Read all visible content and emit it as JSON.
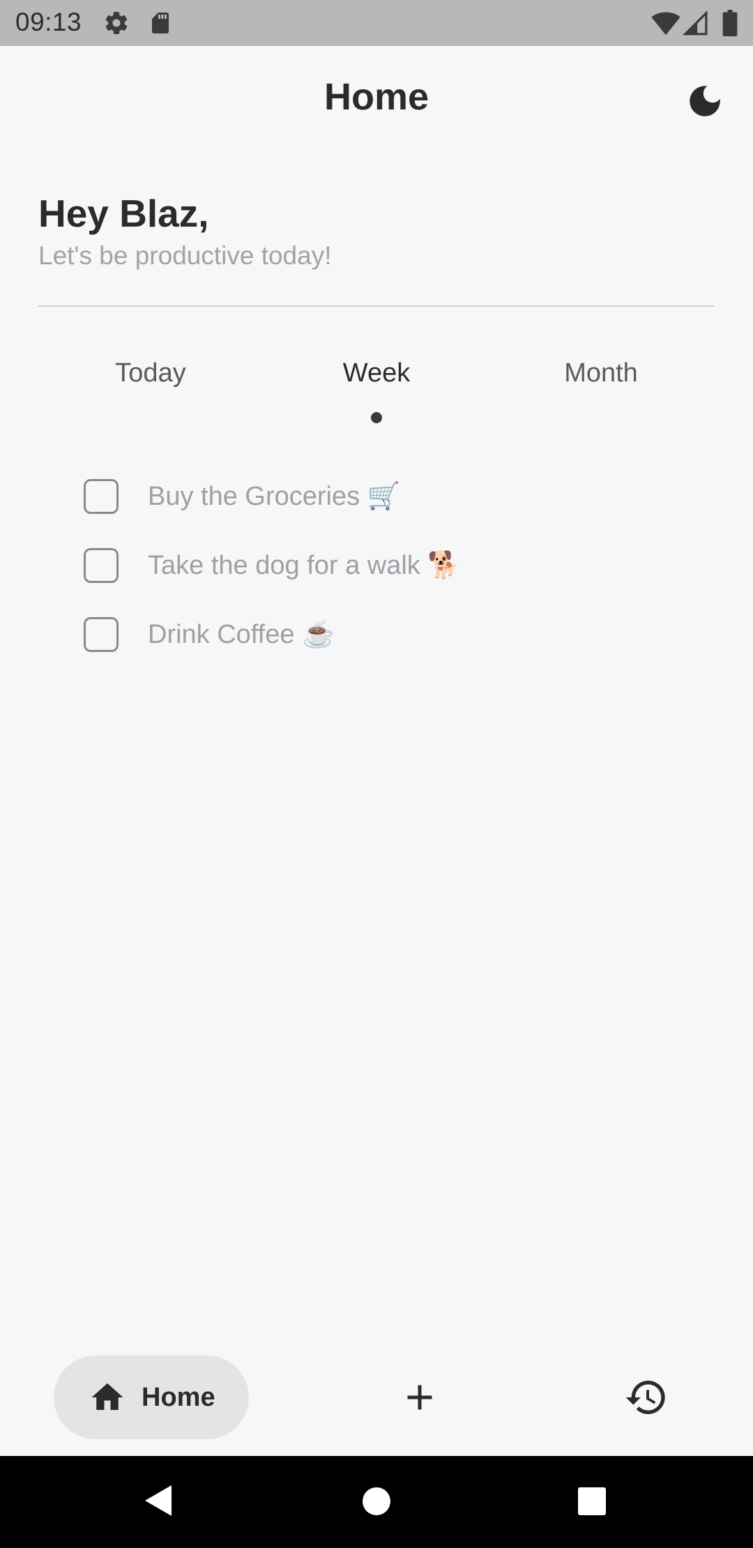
{
  "status_bar": {
    "time": "09:13",
    "icons": [
      "settings-icon",
      "sd-card-icon",
      "wifi-icon",
      "signal-icon",
      "battery-icon"
    ]
  },
  "app_bar": {
    "title": "Home",
    "theme_icon": "moon-icon"
  },
  "greeting": {
    "title": "Hey Blaz,",
    "subtitle": "Let's be productive today!"
  },
  "tabs": [
    {
      "label": "Today",
      "active": false
    },
    {
      "label": "Week",
      "active": true
    },
    {
      "label": "Month",
      "active": false
    }
  ],
  "tasks": [
    {
      "label": "Buy the Groceries 🛒",
      "checked": false
    },
    {
      "label": "Take the dog for a walk 🐕",
      "checked": false
    },
    {
      "label": "Drink Coffee ☕",
      "checked": false
    }
  ],
  "bottom_nav": {
    "home_label": "Home",
    "home_icon": "home-icon",
    "add_icon": "plus-icon",
    "history_icon": "history-icon"
  },
  "colors": {
    "background": "#f7f7f9",
    "status_bar": "#b8b8bb",
    "text_primary": "#2b2b2d",
    "text_muted": "#a0a0a4",
    "nav_pill": "#e4e4e7"
  }
}
